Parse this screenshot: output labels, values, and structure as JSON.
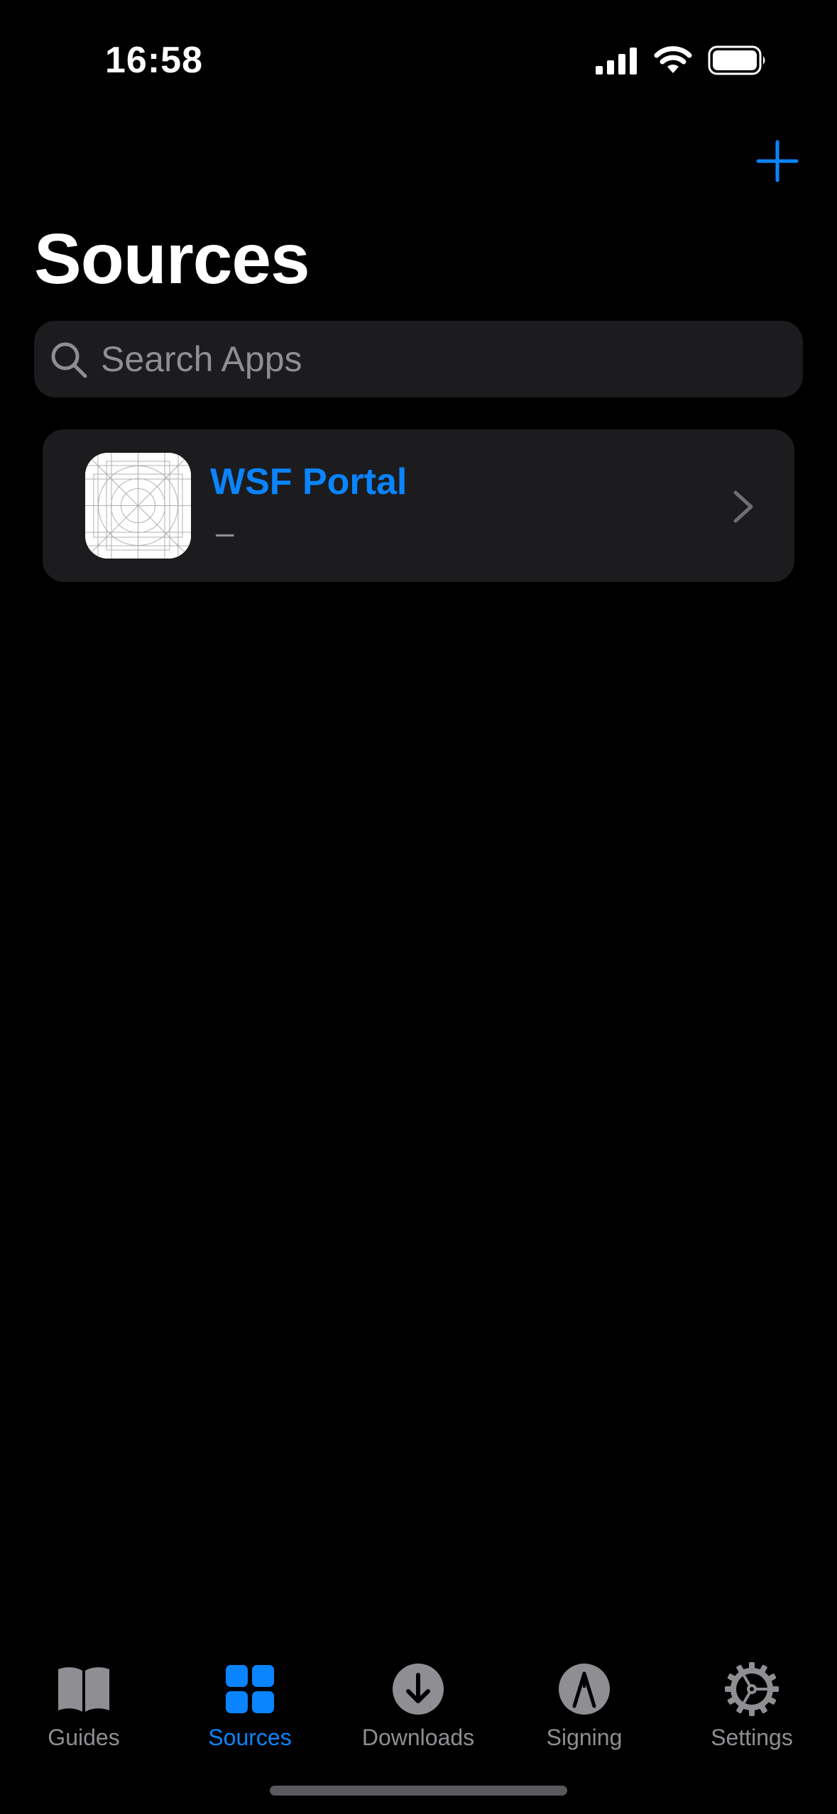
{
  "status_bar": {
    "time": "16:58"
  },
  "header": {
    "title": "Sources",
    "add_icon": "plus-icon"
  },
  "search": {
    "placeholder": "Search Apps",
    "value": ""
  },
  "sources": [
    {
      "name": "WSF Portal",
      "subtitle": "–",
      "icon": "app-icon-placeholder"
    }
  ],
  "tab_bar": {
    "active": "Sources",
    "tabs": [
      {
        "label": "Guides",
        "icon": "book-icon"
      },
      {
        "label": "Sources",
        "icon": "grid-icon"
      },
      {
        "label": "Downloads",
        "icon": "download-icon"
      },
      {
        "label": "Signing",
        "icon": "signing-icon"
      },
      {
        "label": "Settings",
        "icon": "gear-icon"
      }
    ]
  },
  "colors": {
    "background": "#000000",
    "card": "#1c1c1e",
    "accent": "#0a84ff",
    "secondary_text": "#8e8e93"
  }
}
